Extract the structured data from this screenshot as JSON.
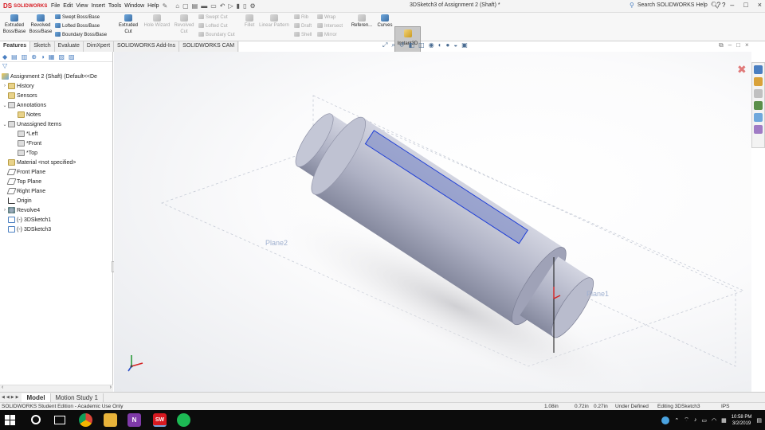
{
  "app": {
    "brand_prefix": "DS",
    "brand": "SOLIDWORKS",
    "menu": [
      "File",
      "Edit",
      "View",
      "Insert",
      "Tools",
      "Window",
      "Help"
    ],
    "doc_title": "3DSketch3 of Assignment 2 (Shaft) *",
    "search_placeholder": "Search SOLIDWORKS Help",
    "window_controls": [
      "?",
      "–",
      "□",
      "×"
    ]
  },
  "command_manager": {
    "extruded_boss": "Extruded\nBoss/Base",
    "revolved_boss": "Revolved\nBoss/Base",
    "sweep_boss": "Swept Boss/Base",
    "lofted_boss": "Lofted Boss/Base",
    "boundary_boss": "Boundary Boss/Base",
    "extruded_cut": "Extruded\nCut",
    "hole_wizard": "Hole Wizard",
    "revolved_cut": "Revolved\nCut",
    "swept_cut": "Swept Cut",
    "lofted_cut": "Lofted Cut",
    "boundary_cut": "Boundary Cut",
    "fillet": "Fillet",
    "linear_pattern": "Linear Pattern",
    "rib": "Rib",
    "draft": "Draft",
    "shell": "Shell",
    "wrap": "Wrap",
    "intersect": "Intersect",
    "mirror": "Mirror",
    "reference": "Referen...",
    "curves": "Curves",
    "instant3d": "Instant3D"
  },
  "tabs": [
    "Features",
    "Sketch",
    "Evaluate",
    "DimXpert",
    "SOLIDWORKS Add-Ins",
    "SOLIDWORKS CAM"
  ],
  "tree": {
    "root": "Assignment 2 (Shaft)  (Default<<De",
    "items": [
      {
        "label": "History",
        "indent": 1,
        "arrow": "›",
        "icon": "folder"
      },
      {
        "label": "Sensors",
        "indent": 1,
        "arrow": "",
        "icon": "folder"
      },
      {
        "label": "Annotations",
        "indent": 1,
        "arrow": "⌄",
        "icon": "annotation"
      },
      {
        "label": "Notes",
        "indent": 2,
        "arrow": "",
        "icon": "folder"
      },
      {
        "label": "Unassigned Items",
        "indent": 1,
        "arrow": "⌄",
        "icon": "annotation"
      },
      {
        "label": "*Left",
        "indent": 2,
        "arrow": "",
        "icon": "annotation"
      },
      {
        "label": "*Front",
        "indent": 2,
        "arrow": "",
        "icon": "annotation"
      },
      {
        "label": "*Top",
        "indent": 2,
        "arrow": "",
        "icon": "annotation"
      },
      {
        "label": "Material <not specified>",
        "indent": 1,
        "arrow": "",
        "icon": "material"
      },
      {
        "label": "Front Plane",
        "indent": 1,
        "arrow": "",
        "icon": "plane"
      },
      {
        "label": "Top Plane",
        "indent": 1,
        "arrow": "",
        "icon": "plane"
      },
      {
        "label": "Right Plane",
        "indent": 1,
        "arrow": "",
        "icon": "plane"
      },
      {
        "label": "Origin",
        "indent": 1,
        "arrow": "",
        "icon": "origin"
      },
      {
        "label": "Revolve4",
        "indent": 1,
        "arrow": "›",
        "icon": "revolve"
      },
      {
        "label": "(-) 3DSketch1",
        "indent": 1,
        "arrow": "",
        "icon": "sketch"
      },
      {
        "label": "(-) 3DSketch3",
        "indent": 1,
        "arrow": "",
        "icon": "sketch"
      }
    ]
  },
  "viewport": {
    "plane2_label": "Plane2",
    "plane1_label": "Plane1"
  },
  "bottom_tabs": [
    "Model",
    "Motion Study 1"
  ],
  "status": {
    "edition": "SOLIDWORKS Student Edition - Academic Use Only",
    "coord1": "1.08in",
    "coord2": "0.72in",
    "coord3": "0.27in",
    "state": "Under Defined",
    "editing": "Editing 3DSketch3",
    "units": "IPS"
  },
  "taskbar": {
    "time": "10:58 PM",
    "date": "3/2/2019"
  },
  "colors": {
    "shaft": "#b5b8ca",
    "shaft_dark": "#8e91a6",
    "face_highlight": "#8a96c9",
    "plane_text": "#9fb0cf",
    "accent": "#d71920"
  }
}
